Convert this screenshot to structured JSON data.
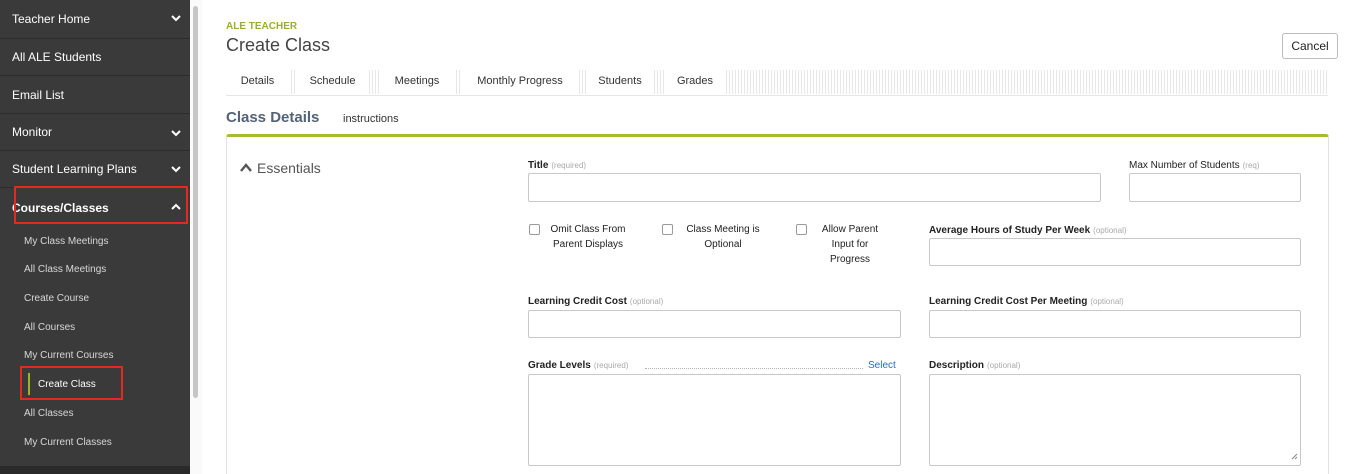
{
  "sidebar": {
    "items": [
      {
        "label": "Teacher Home",
        "chevron": "down"
      },
      {
        "label": "All ALE Students",
        "chevron": ""
      },
      {
        "label": "Email List",
        "chevron": ""
      },
      {
        "label": "Monitor",
        "chevron": "down"
      },
      {
        "label": "Student Learning Plans",
        "chevron": "down"
      },
      {
        "label": "Courses/Classes",
        "chevron": "up"
      }
    ],
    "sub_items": [
      "My Class Meetings",
      "All Class Meetings",
      "Create Course",
      "All Courses",
      "My Current Courses",
      "Create Class",
      "All Classes",
      "My Current Classes"
    ],
    "active_sub_item": "Create Class"
  },
  "header": {
    "app_label": "ALE TEACHER",
    "page_title": "Create Class",
    "cancel_label": "Cancel"
  },
  "tabs": [
    "Details",
    "Schedule",
    "Meetings",
    "Monthly Progress",
    "Students",
    "Grades"
  ],
  "section": {
    "title": "Class Details",
    "subtitle": "instructions"
  },
  "essentials": {
    "title": "Essentials",
    "title_label": "Title",
    "title_hint": "(required)",
    "title_value": "",
    "max_students_label": "Max Number of Students",
    "max_students_hint": "(req)",
    "max_students_value": "",
    "checkboxes": [
      {
        "line1": "Omit Class From",
        "line2": "Parent Displays",
        "line3": "",
        "checked": false
      },
      {
        "line1": "Class Meeting is",
        "line2": "Optional",
        "line3": "",
        "checked": false
      },
      {
        "line1": "Allow Parent",
        "line2": "Input for",
        "line3": "Progress",
        "checked": false
      }
    ],
    "avg_hours_label": "Average Hours of Study Per Week",
    "avg_hours_hint": "(optional)",
    "avg_hours_value": "",
    "credit_cost_label": "Learning Credit Cost",
    "credit_cost_hint": "(optional)",
    "credit_cost_value": "",
    "credit_cost_meeting_label": "Learning Credit Cost Per Meeting",
    "credit_cost_meeting_hint": "(optional)",
    "credit_cost_meeting_value": "",
    "grade_levels_label": "Grade Levels",
    "grade_levels_hint": "(required)",
    "grade_levels_select": "Select",
    "description_label": "Description",
    "description_hint": "(optional)",
    "description_value": ""
  },
  "colors": {
    "sidebar_bg": "#3a3a3a",
    "accent": "#a6bc2c",
    "highlight": "#e32b1d",
    "link": "#1f6fd2",
    "section_title": "#52637a"
  },
  "icons": [
    "chevron-down-icon",
    "chevron-up-icon",
    "caret-up-icon",
    "resize-handle-icon"
  ]
}
